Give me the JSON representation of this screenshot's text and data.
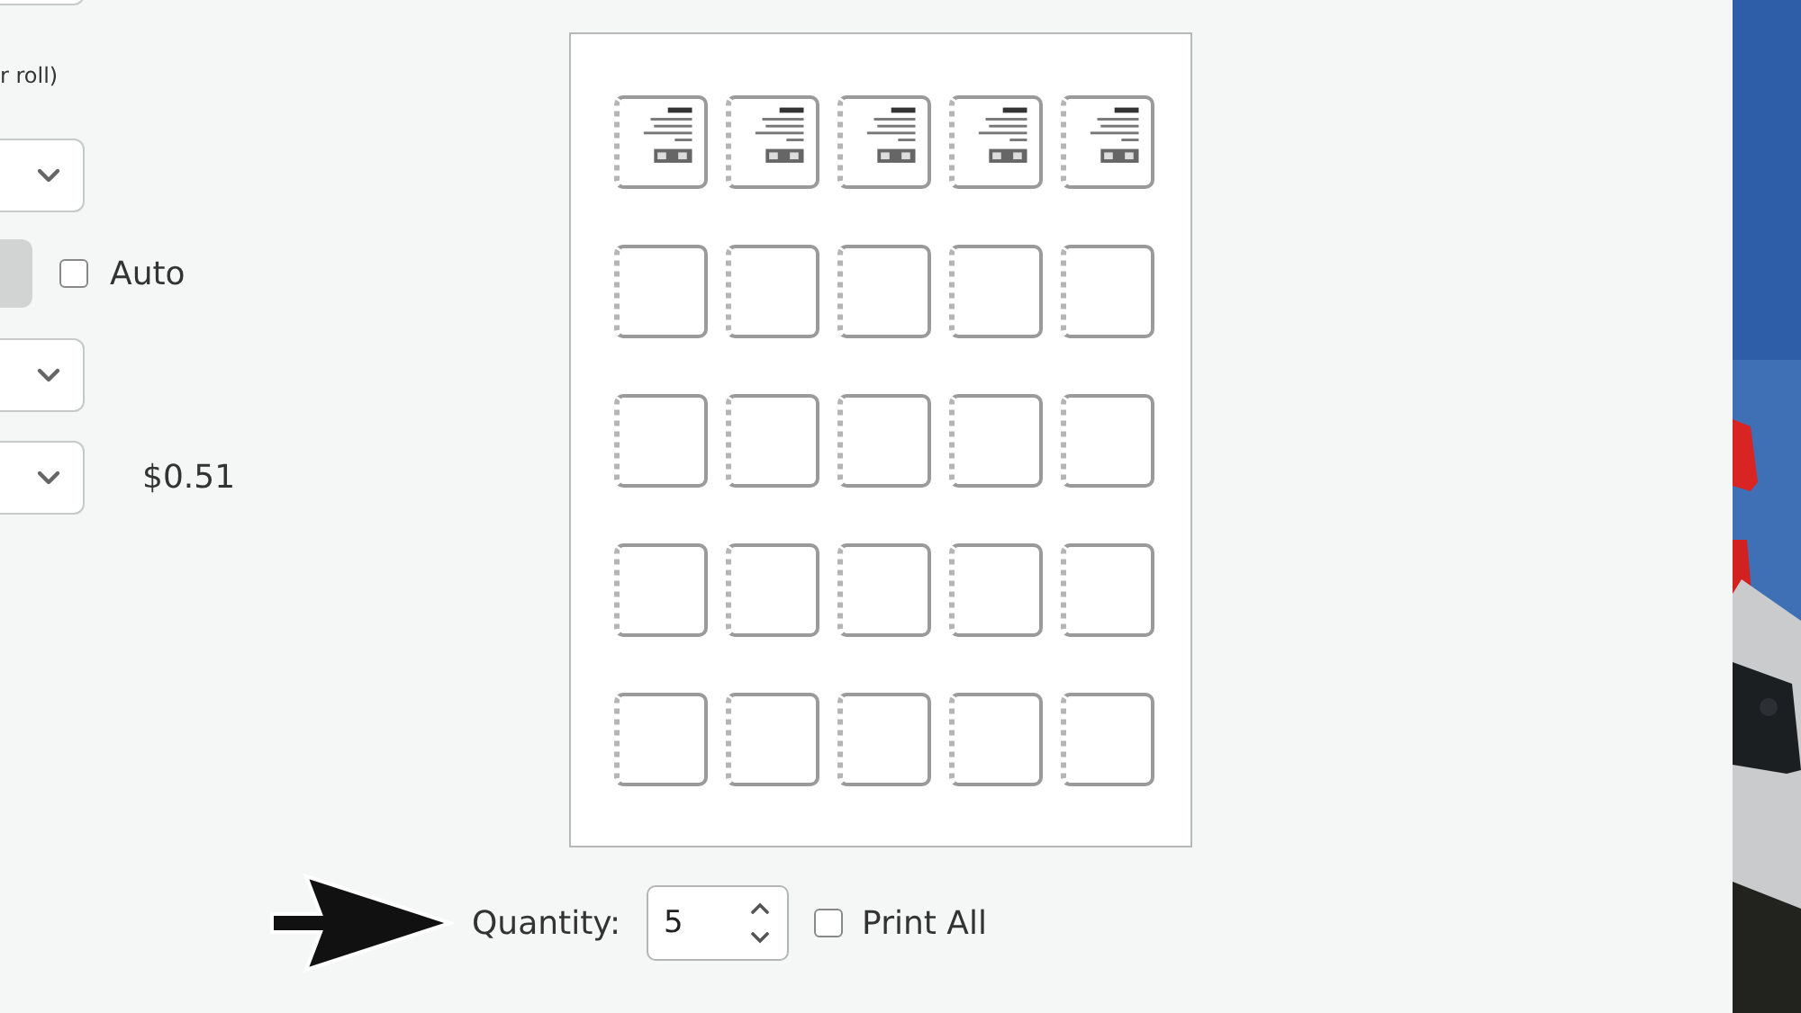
{
  "settings": {
    "roll_note": "r roll)",
    "fields": [
      {
        "kind": "select"
      },
      {
        "kind": "select"
      },
      {
        "kind": "button",
        "auto_label": "Auto",
        "auto_checked": false
      },
      {
        "kind": "select"
      },
      {
        "kind": "select",
        "price": "$0.51"
      }
    ]
  },
  "sheet": {
    "labels": [
      {
        "printed": true
      },
      {
        "printed": true
      },
      {
        "printed": true
      },
      {
        "printed": true
      },
      {
        "printed": true
      },
      {
        "printed": false
      },
      {
        "printed": false
      },
      {
        "printed": false
      },
      {
        "printed": false
      },
      {
        "printed": false
      },
      {
        "printed": false
      },
      {
        "printed": false
      },
      {
        "printed": false
      },
      {
        "printed": false
      },
      {
        "printed": false
      },
      {
        "printed": false
      },
      {
        "printed": false
      },
      {
        "printed": false
      },
      {
        "printed": false
      },
      {
        "printed": false
      },
      {
        "printed": false
      },
      {
        "printed": false
      },
      {
        "printed": false
      },
      {
        "printed": false
      },
      {
        "printed": false
      }
    ]
  },
  "quantity": {
    "label": "Quantity:",
    "value": "5",
    "print_all_label": "Print All",
    "print_all_checked": false
  }
}
